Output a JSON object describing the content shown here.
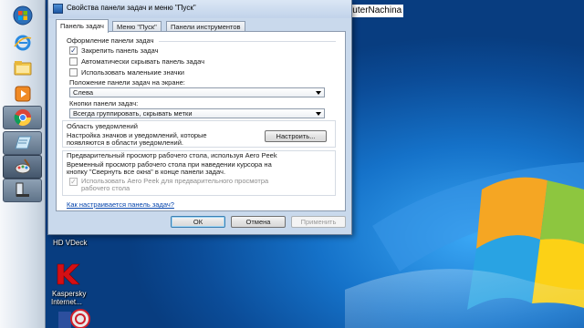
{
  "overlay": {
    "url": "https://www.youtube.com/user/KomputerNachina"
  },
  "dialog": {
    "title": "Свойства панели задач и меню \"Пуск\"",
    "tabs": [
      "Панель задач",
      "Меню \"Пуск\"",
      "Панели инструментов"
    ],
    "appearance": {
      "heading": "Оформление панели задач",
      "lock": {
        "label": "Закрепить панель задач",
        "checked": true
      },
      "autohide": {
        "label": "Автоматически скрывать панель задач",
        "checked": false
      },
      "small_icons": {
        "label": "Использовать маленькие значки",
        "checked": false
      },
      "position_label": "Положение панели задач на экране:",
      "position_value": "Слева",
      "buttons_label": "Кнопки панели задач:",
      "buttons_value": "Всегда группировать, скрывать метки"
    },
    "notifications": {
      "heading": "Область уведомлений",
      "text_line1": "Настройка значков и уведомлений, которые",
      "text_line2": "появляются в области уведомлений.",
      "configure_button": "Настроить..."
    },
    "aero_peek": {
      "heading": "Предварительный просмотр рабочего стола, используя Aero Peek",
      "desc_line1": "Временный просмотр рабочего стола при наведении курсора на",
      "desc_line2": "кнопку \"Свернуть все окна\" в конце панели задач.",
      "checkbox_line1": "Использовать Aero Peek для предварительного просмотра",
      "checkbox_line2": "рабочего стола",
      "checked": true,
      "enabled": false
    },
    "help_link": "Как настраивается панель задач?",
    "ok_button": "ОК",
    "cancel_button": "Отмена",
    "apply_button": "Применить"
  },
  "desktop": {
    "icons": [
      {
        "label": "HD VDeck"
      },
      {
        "label": "Kaspersky"
      },
      {
        "label": "Internet..."
      }
    ]
  },
  "taskbar": {
    "buttons": [
      "start-orb",
      "internet-explorer",
      "windows-explorer",
      "media-player",
      "google-chrome",
      "notepad",
      "paint",
      "taskbar-properties"
    ]
  }
}
